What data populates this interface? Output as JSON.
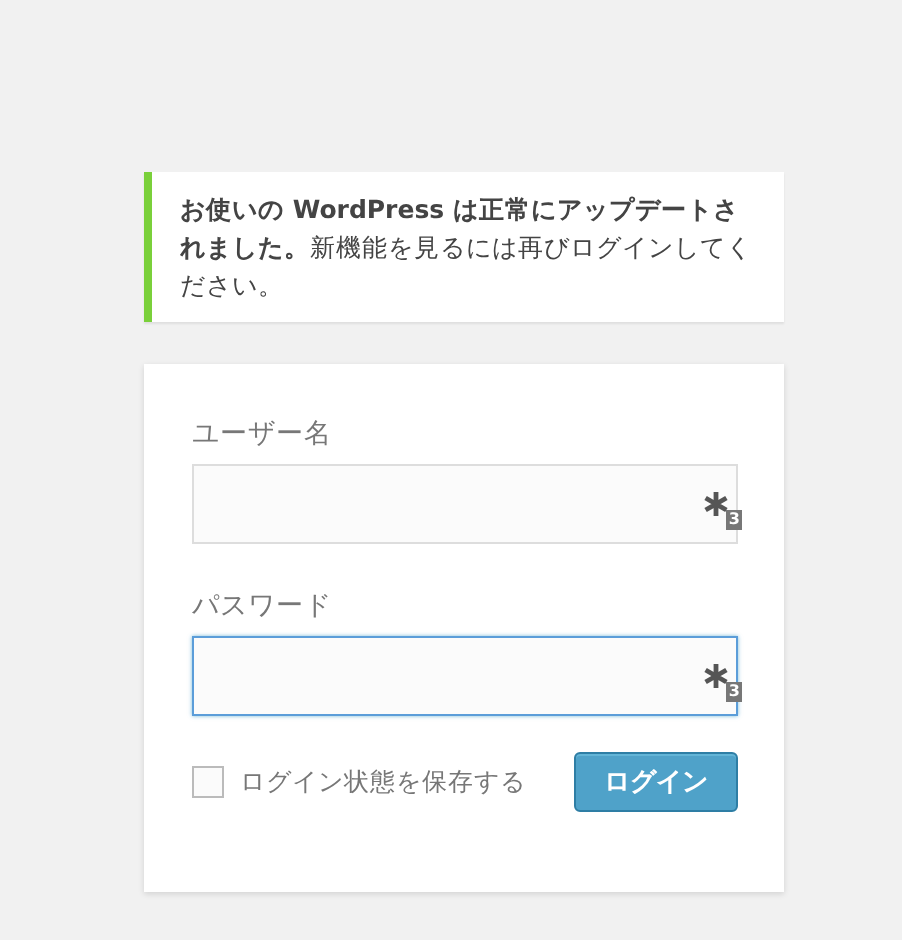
{
  "notice": {
    "message": "**お使いの WordPress は正常にアップデートされました。**新機能を見るには再びログインしてください。"
  },
  "fields": [
    {
      "label": "ユーザー名",
      "focused": false,
      "badge": "3"
    },
    {
      "label": "パスワード",
      "focused": true,
      "badge": "3"
    }
  ],
  "remember": {
    "label": "ログイン状態を保存する",
    "checked": false
  },
  "submit": {
    "label": "ログイン"
  }
}
